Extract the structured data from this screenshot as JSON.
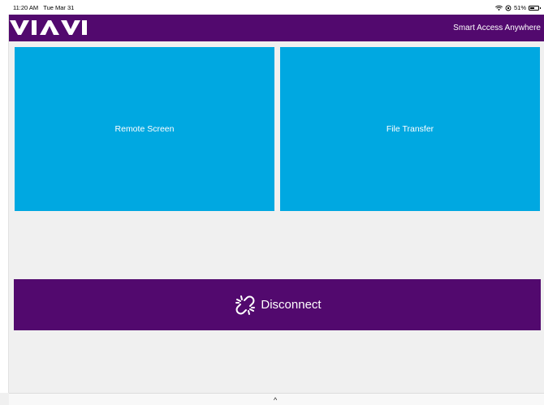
{
  "status_bar": {
    "time": "11:20 AM",
    "date": "Tue Mar 31",
    "battery_percent": "51%",
    "battery_level": 0.51
  },
  "header": {
    "brand": "VIAVI",
    "tagline": "Smart Access Anywhere",
    "background_color": "#52096e"
  },
  "tiles": [
    {
      "label": "Remote Screen",
      "color": "#00a8e1"
    },
    {
      "label": "File Transfer",
      "color": "#00a8e1"
    }
  ],
  "disconnect": {
    "label": "Disconnect",
    "icon": "broken-link-icon",
    "color": "#52096e"
  },
  "bottom_bar": {
    "chevron": "^",
    "icon": "chevron-up-icon"
  }
}
